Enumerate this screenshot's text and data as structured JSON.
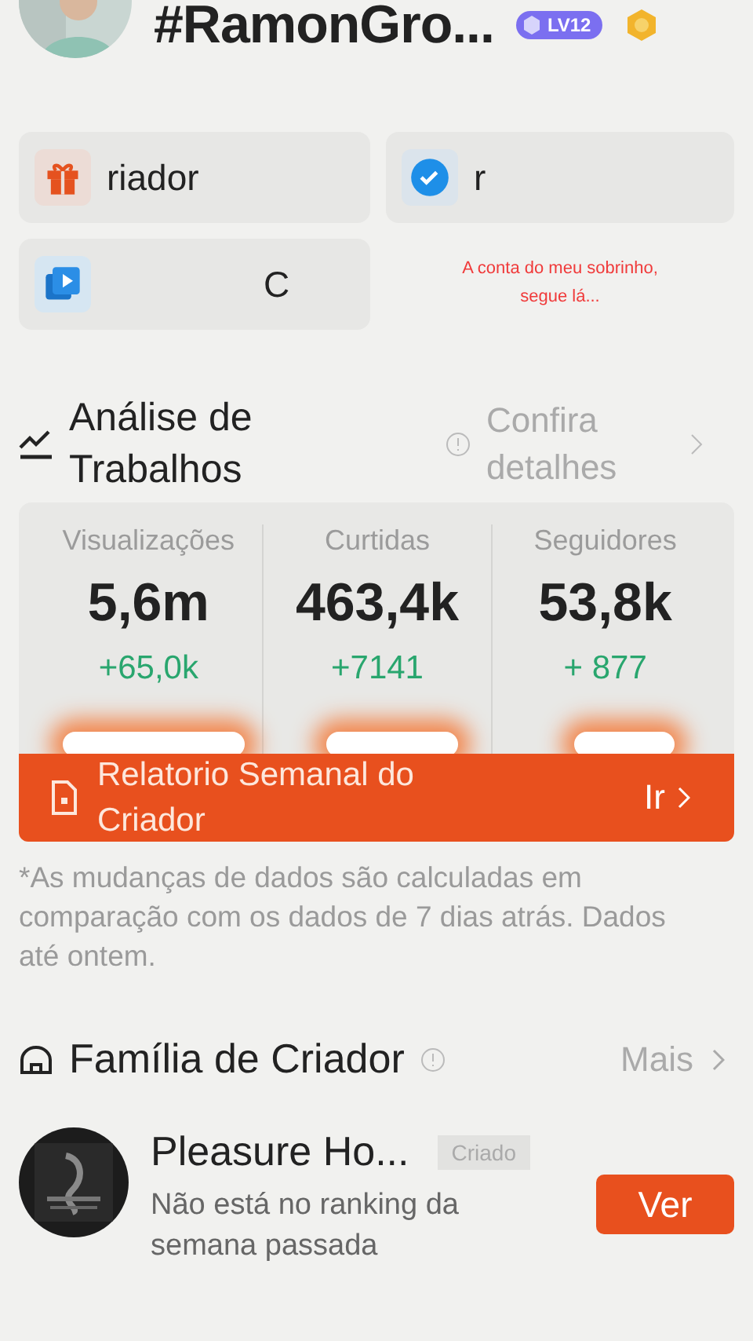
{
  "profile": {
    "name": "#RamonGro...",
    "level_badge": "LV12"
  },
  "shortcuts": [
    {
      "kind": "gift",
      "label": "riador"
    },
    {
      "kind": "verified",
      "label": "r"
    },
    {
      "kind": "video",
      "label": "C"
    }
  ],
  "caption": "A conta do meu sobrinho, segue lá...",
  "analysis": {
    "title": "Análise de Trabalhos",
    "link": "Confira detalhes",
    "stats": [
      {
        "label": "Visualizações",
        "value": "5,6m",
        "change": "+65,0k"
      },
      {
        "label": "Curtidas",
        "value": "463,4k",
        "change": "+7141"
      },
      {
        "label": "Seguidores",
        "value": "53,8k",
        "change": "+ 877"
      }
    ],
    "banner": {
      "label": "Relatorio Semanal do Criador",
      "action": "Ir"
    },
    "note": "*As mudanças de dados são calculadas em comparação com os dados de 7 dias atrás. Dados até ontem."
  },
  "family": {
    "title": "Família de Criador",
    "more": "Mais",
    "items": [
      {
        "name": "Pleasure Ho...",
        "tag": "Criado",
        "status": "Não está no ranking da semana passada",
        "action": "Ver"
      }
    ]
  }
}
